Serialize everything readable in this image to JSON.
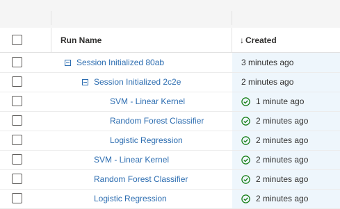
{
  "header": {
    "run_name": "Run Name",
    "created": "Created",
    "sort_arrow": "↓"
  },
  "colors": {
    "link": "#2b6cb0",
    "success": "#107c10",
    "created_column_bg": "#eef6fc"
  },
  "rows": [
    {
      "name": "Session Initialized 80ab",
      "level": 1,
      "collapsible": true,
      "created": "3 minutes ago",
      "status": ""
    },
    {
      "name": "Session Initialized 2c2e",
      "level": 2,
      "collapsible": true,
      "created": "2 minutes ago",
      "status": ""
    },
    {
      "name": "SVM - Linear Kernel",
      "level": 3,
      "collapsible": false,
      "created": "1 minute ago",
      "status": "success"
    },
    {
      "name": "Random Forest Classifier",
      "level": 3,
      "collapsible": false,
      "created": "2 minutes ago",
      "status": "success"
    },
    {
      "name": "Logistic Regression",
      "level": 3,
      "collapsible": false,
      "created": "2 minutes ago",
      "status": "success"
    },
    {
      "name": "SVM - Linear Kernel",
      "level": 2,
      "collapsible": false,
      "created": "2 minutes ago",
      "status": "success"
    },
    {
      "name": "Random Forest Classifier",
      "level": 2,
      "collapsible": false,
      "created": "2 minutes ago",
      "status": "success"
    },
    {
      "name": "Logistic Regression",
      "level": 2,
      "collapsible": false,
      "created": "2 minutes ago",
      "status": "success"
    }
  ]
}
